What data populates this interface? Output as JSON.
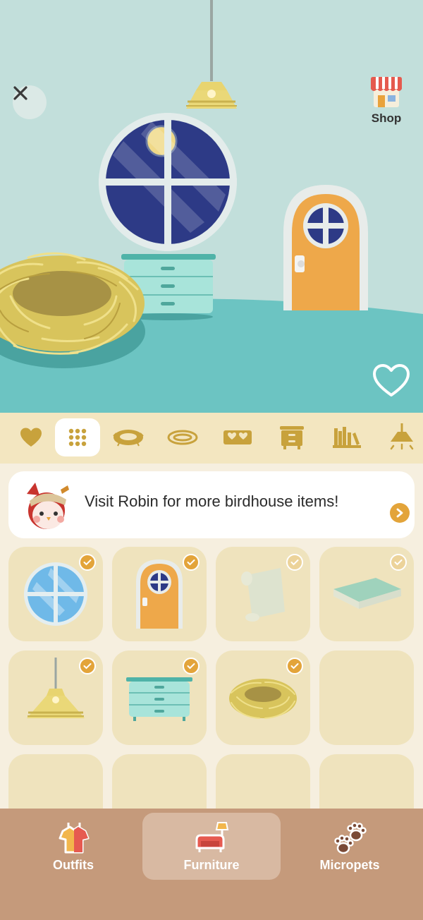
{
  "header": {
    "shop_label": "Shop"
  },
  "scene": {
    "close_icon": "close-icon",
    "shop_icon": "shop-icon",
    "favorite_icon": "heart-outline-icon"
  },
  "categories": [
    {
      "icon": "heart-icon",
      "selected": false
    },
    {
      "icon": "grid-icon",
      "selected": true
    },
    {
      "icon": "nest-icon",
      "selected": false
    },
    {
      "icon": "oval-rug-icon",
      "selected": false
    },
    {
      "icon": "doormat-icon",
      "selected": false
    },
    {
      "icon": "drawer-icon",
      "selected": false
    },
    {
      "icon": "bookshelf-icon",
      "selected": false
    },
    {
      "icon": "ceiling-lamp-icon",
      "selected": false
    }
  ],
  "banner": {
    "text": "Visit Robin for more birdhouse items!"
  },
  "items": [
    {
      "name": "round-window",
      "owned": true,
      "checked": true
    },
    {
      "name": "orange-door",
      "owned": true,
      "checked": true
    },
    {
      "name": "wallpaper-scroll",
      "owned": true,
      "checked": false
    },
    {
      "name": "teal-floor-tile",
      "owned": true,
      "checked": false
    },
    {
      "name": "pendant-lamp",
      "owned": true,
      "checked": true
    },
    {
      "name": "teal-dresser",
      "owned": true,
      "checked": true
    },
    {
      "name": "straw-nest",
      "owned": true,
      "checked": true
    },
    {
      "name": "empty",
      "owned": false,
      "checked": false
    }
  ],
  "nav": {
    "items": [
      {
        "label": "Outfits",
        "icon": "outfits-icon",
        "active": false
      },
      {
        "label": "Furniture",
        "icon": "furniture-icon",
        "active": true
      },
      {
        "label": "Micropets",
        "icon": "micropets-icon",
        "active": false
      }
    ]
  },
  "colors": {
    "accent": "#e3a43a",
    "scene_wall": "#c2dfdb",
    "scene_floor": "#6cc4c2",
    "tab_bar": "#f3e6c0",
    "nav_bg": "#c59a7b"
  }
}
